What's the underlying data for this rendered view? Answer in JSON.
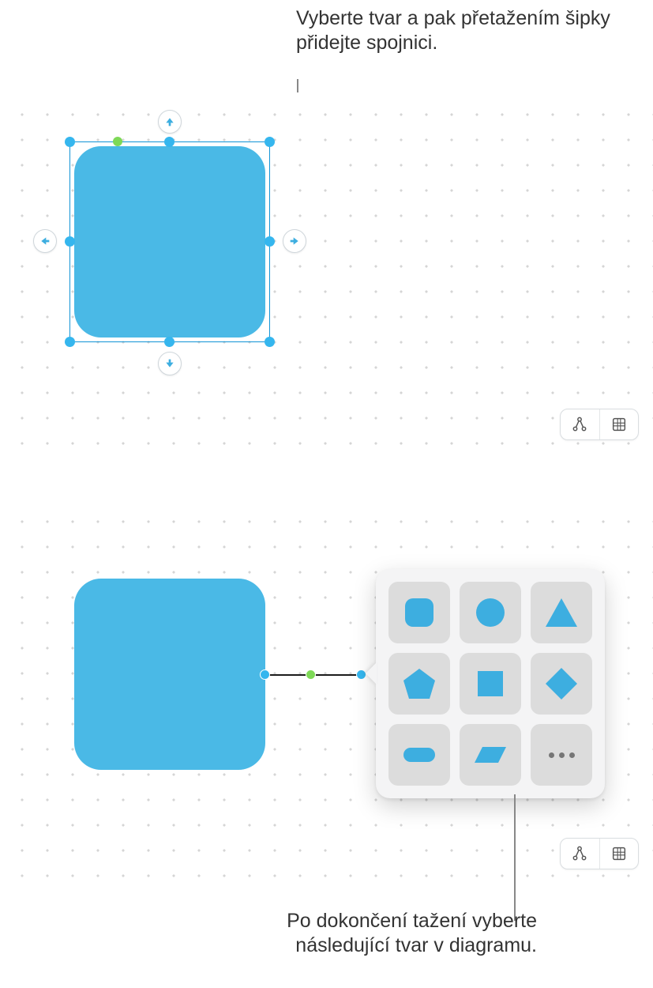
{
  "callouts": {
    "top": "Vyberte tvar a pak přetažením šipky přidejte spojnici.",
    "bottom": "Po dokončení tažení vyberte následující tvar v diagramu."
  },
  "canvas_top": {
    "selected_shape": "rounded-rectangle",
    "shape_color": "#4ab9e6",
    "connector_arrows": [
      "up",
      "right",
      "down",
      "left"
    ]
  },
  "canvas_bottom": {
    "shape": "rounded-rectangle",
    "shape_color": "#4ab9e6",
    "connector_drawn": true,
    "shape_picker": {
      "options": [
        "rounded-square",
        "circle",
        "triangle",
        "pentagon",
        "square",
        "diamond",
        "capsule",
        "parallelogram",
        "more"
      ]
    }
  },
  "mini_toolbar": {
    "buttons": [
      "diagram-mode",
      "grid-mode"
    ]
  },
  "colors": {
    "shape_fill": "#4ab9e6",
    "selection": "#1294d6",
    "handle": "#35b6ee",
    "rotation_handle": "#7ed957",
    "popover_bg": "#f4f4f5",
    "cell_bg": "#dcdcdc"
  }
}
